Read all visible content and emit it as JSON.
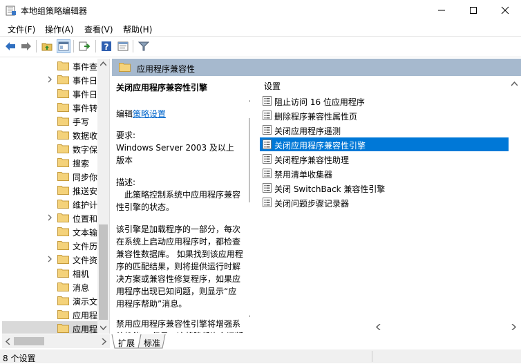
{
  "window": {
    "title": "本地组策略编辑器"
  },
  "menu": [
    {
      "label": "文件(F)"
    },
    {
      "label": "操作(A)"
    },
    {
      "label": "查看(V)"
    },
    {
      "label": "帮助(H)"
    }
  ],
  "tree": {
    "items": [
      {
        "label": "事件查",
        "chevron": false
      },
      {
        "label": "事件日",
        "chevron": true
      },
      {
        "label": "事件日",
        "chevron": false
      },
      {
        "label": "事件转",
        "chevron": false
      },
      {
        "label": "手写",
        "chevron": false
      },
      {
        "label": "数据收",
        "chevron": false
      },
      {
        "label": "数字保",
        "chevron": false
      },
      {
        "label": "搜索",
        "chevron": false
      },
      {
        "label": "同步你",
        "chevron": false
      },
      {
        "label": "推送安",
        "chevron": false
      },
      {
        "label": "维护计",
        "chevron": false
      },
      {
        "label": "位置和",
        "chevron": true
      },
      {
        "label": "文本输",
        "chevron": false
      },
      {
        "label": "文件历",
        "chevron": false
      },
      {
        "label": "文件资",
        "chevron": true
      },
      {
        "label": "相机",
        "chevron": false
      },
      {
        "label": "消息",
        "chevron": false
      },
      {
        "label": "演示文",
        "chevron": false
      },
      {
        "label": "应用程",
        "chevron": false
      },
      {
        "label": "应用程",
        "chevron": false,
        "selected": true
      }
    ]
  },
  "right": {
    "header_title": "应用程序兼容性",
    "description": {
      "title": "关闭应用程序兼容性引擎",
      "edit_prefix": "编辑",
      "edit_link": "策略设置",
      "requirements_label": "要求:",
      "requirements_text": "Windows Server 2003 及以上版本",
      "desc_label": "描述:",
      "desc_text": "此策略控制系统中应用程序兼容性引擎的状态。",
      "para1": "该引擎是加载程序的一部分，每次在系统上启动应用程序时，都检查兼容性数据库。 如果找到该应用程序的匹配结果，则将提供运行时解决方案或兼容性修复程序，如果应用程序出现已知问题，则显示“应用程序帮助”消息。",
      "para2": "禁用应用程序兼容性引擎将增强系统性能。 但是，这将降低许多旧版"
    },
    "settings_column": "设置",
    "settings": [
      {
        "label": "阻止访问 16 位应用程序"
      },
      {
        "label": "删除程序兼容性属性页"
      },
      {
        "label": "关闭应用程序遥测"
      },
      {
        "label": "关闭应用程序兼容性引擎",
        "selected": true
      },
      {
        "label": "关闭程序兼容性助理"
      },
      {
        "label": "禁用清单收集器"
      },
      {
        "label": "关闭 SwitchBack 兼容性引擎"
      },
      {
        "label": "关闭问题步骤记录器"
      }
    ],
    "tabs": [
      {
        "label": "扩展"
      },
      {
        "label": "标准"
      }
    ]
  },
  "status": {
    "text": "8 个设置"
  },
  "colors": {
    "header_bg": "#a6b9ce",
    "selection": "#0078d7"
  }
}
